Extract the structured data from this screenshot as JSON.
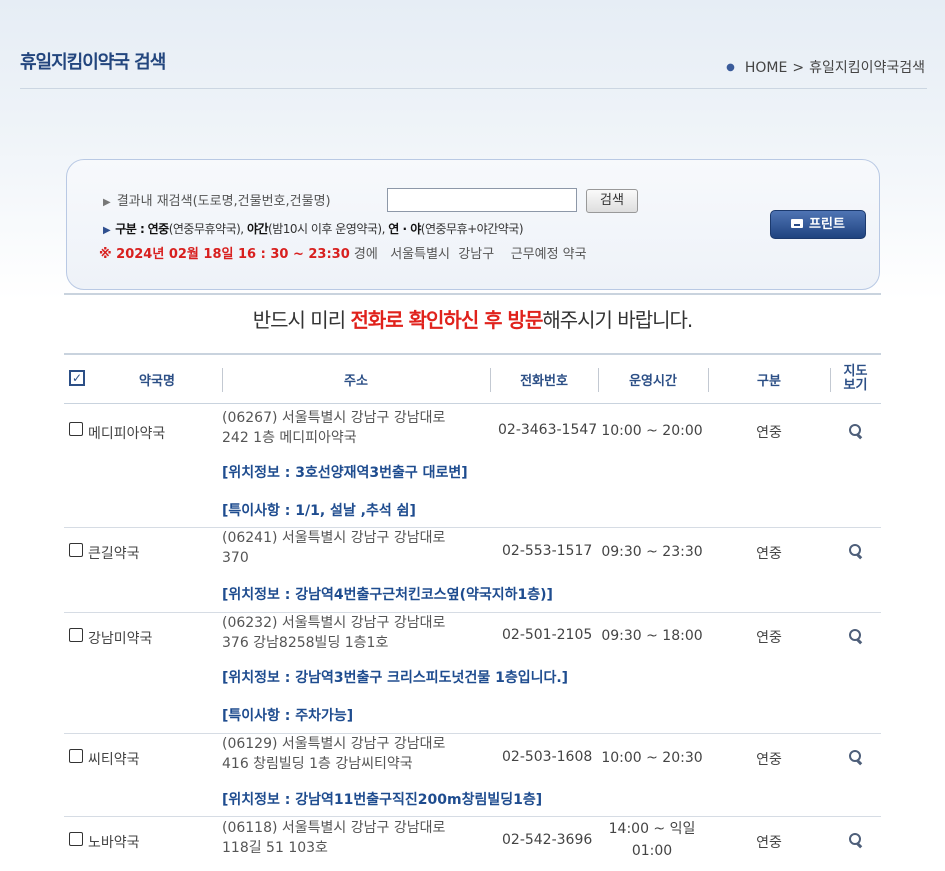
{
  "page": {
    "title": "휴일지킴이약국 검색",
    "breadcrumb": [
      "HOME",
      "휴일지킴이약국검색"
    ],
    "breadcrumb_sep": ">"
  },
  "search": {
    "label": "결과내 재검색(도로명,건물번호,건물명)",
    "input_value": "",
    "button_label": "검색",
    "legend_prefix": "구분 :",
    "legend_yj": "연중",
    "legend_yj_desc": "(연중무휴약국),",
    "legend_ya": "야간",
    "legend_ya_desc": "(밤10시 이후 운영약국),",
    "legend_both": "연 · 야",
    "legend_both_desc": "(연중무휴+야간약국)",
    "date_text": "※ 2024년 02월 18일 16 : 30 ~ 23:30",
    "date_suffix": "경에",
    "region_text": "서울특별시  강남구",
    "duty_text": "근무예정 약국",
    "print_label": "프린트"
  },
  "notice": {
    "before": "반드시 미리 ",
    "highlight": "전화로 확인하신 후 방문",
    "after": "해주시기 바랍니다."
  },
  "table": {
    "headers": {
      "name": "약국명",
      "address": "주소",
      "phone": "전화번호",
      "hours": "운영시간",
      "kind": "구분",
      "map_l1": "지도",
      "map_l2": "보기"
    },
    "rows": [
      {
        "name": "메디피아약국",
        "address_l1": "(06267) 서울특별시 강남구 강남대로",
        "address_l2": "242 1층 메디피아약국",
        "phone": "02-3463-1547",
        "hours_l1": "10:00 ~ 20:00",
        "hours_l2": "",
        "kind": "연중",
        "location": "[위치정보 : 3호선양재역3번출구 대로변]",
        "note": "[특이사항 : 1/1, 설날 ,추석 쉼]"
      },
      {
        "name": "큰길약국",
        "address_l1": "(06241) 서울특별시 강남구 강남대로",
        "address_l2": "370",
        "phone": "02-553-1517",
        "hours_l1": "09:30 ~ 23:30",
        "hours_l2": "",
        "kind": "연중",
        "location": "[위치정보 : 강남역4번출구근처킨코스옆(약국지하1층)]",
        "note": ""
      },
      {
        "name": "강남미약국",
        "address_l1": "(06232) 서울특별시 강남구 강남대로",
        "address_l2": "376 강남8258빌딩 1층1호",
        "phone": "02-501-2105",
        "hours_l1": "09:30 ~ 18:00",
        "hours_l2": "",
        "kind": "연중",
        "location": "[위치정보 : 강남역3번출구 크리스피도넛건물 1층입니다.]",
        "note": "[특이사항 : 주차가능]"
      },
      {
        "name": "씨티약국",
        "address_l1": "(06129) 서울특별시 강남구 강남대로",
        "address_l2": "416 창림빌딩 1층 강남씨티약국",
        "phone": "02-503-1608",
        "hours_l1": "10:00 ~ 20:30",
        "hours_l2": "",
        "kind": "연중",
        "location": "[위치정보 : 강남역11번출구직진200m창림빌딩1층]",
        "note": ""
      },
      {
        "name": "노바약국",
        "address_l1": "(06118) 서울특별시 강남구 강남대로",
        "address_l2": "118길 51 103호",
        "phone": "02-542-3696",
        "hours_l1": "14:00 ~ 익일",
        "hours_l2": "01:00",
        "kind": "연중",
        "location": "",
        "note": ""
      }
    ]
  },
  "icons": {
    "map": "magnifier-icon",
    "print": "printer-icon",
    "checkbox": "checkbox-icon"
  },
  "colors": {
    "title": "#23467e",
    "accent_blue": "#1e4c8f",
    "alert_red": "#d8201f",
    "print_button": "#2d538f"
  }
}
